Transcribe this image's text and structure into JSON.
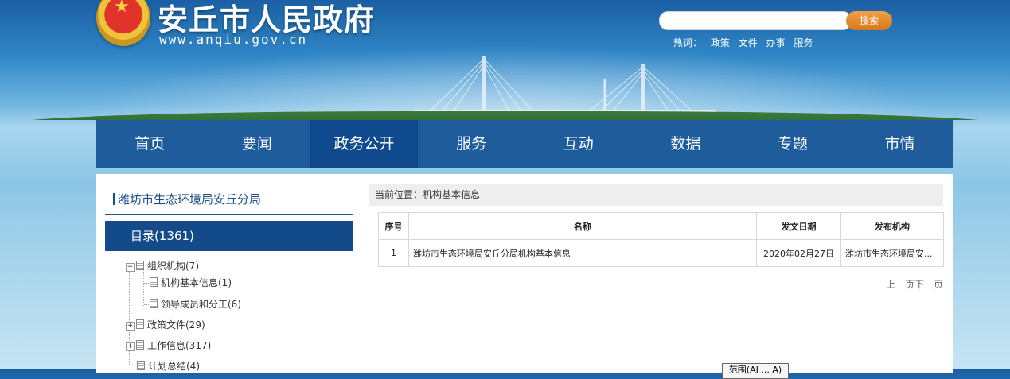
{
  "header": {
    "site_title": "安丘市人民政府",
    "site_url": "www.anqiu.gov.cn",
    "search": {
      "placeholder": "",
      "button_label": "搜索"
    },
    "hotwords": {
      "label": "热词：",
      "items": [
        "政策",
        "文件",
        "办事",
        "服务"
      ]
    }
  },
  "nav": {
    "items": [
      {
        "label": "首页"
      },
      {
        "label": "要闻"
      },
      {
        "label": "政务公开"
      },
      {
        "label": "服务"
      },
      {
        "label": "互动"
      },
      {
        "label": "数据"
      },
      {
        "label": "专题"
      },
      {
        "label": "市情"
      }
    ],
    "active_index": 2
  },
  "sidebar": {
    "title": "潍坊市生态环境局安丘分局",
    "catalog_label": "目录(1361)",
    "tree": [
      {
        "toggle": "−",
        "label": "组织机构(7)"
      },
      {
        "toggle": "",
        "label": "机构基本信息(1)"
      },
      {
        "toggle": "",
        "label": "领导成员和分工(6)"
      },
      {
        "toggle": "+",
        "label": "政策文件(29)"
      },
      {
        "toggle": "+",
        "label": "工作信息(317)"
      },
      {
        "toggle": "",
        "label": "计划总结(4)"
      }
    ]
  },
  "main": {
    "breadcrumb": "当前位置：机构基本信息",
    "table": {
      "headers": [
        "序号",
        "名称",
        "发文日期",
        "发布机构"
      ],
      "rows": [
        [
          "1",
          "潍坊市生态环境局安丘分局机构基本信息",
          "2020年02月27日",
          "潍坊市生态环境局安..."
        ]
      ]
    },
    "pager": {
      "prev": "上一页",
      "next": "下一页"
    },
    "scope_button": "范围(AI ... A)"
  },
  "colors": {
    "nav_bg": "#1f5c9c",
    "nav_active": "#0f4a8e",
    "search_button": "#e08a2a",
    "accent_text": "#1a4f8b"
  }
}
